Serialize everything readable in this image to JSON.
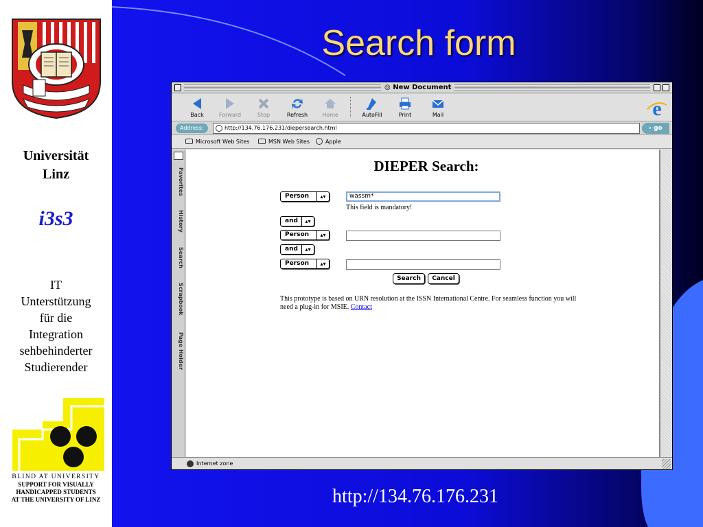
{
  "slide": {
    "title": "Search form",
    "footer_url": "http://134.76.176.231"
  },
  "sidebar": {
    "university": [
      "Universität",
      "Linz"
    ],
    "i3s3": "i3s3",
    "description": [
      "IT",
      "Unterstützung",
      "für die",
      "Integration",
      "sehbehinderter",
      "Studierender"
    ],
    "blind_logo_text": [
      "BLIND AT UNIVERSITY",
      "SUPPORT FOR VISUALLY",
      "HANDICAPPED STUDENTS",
      "AT THE UNIVERSITY OF LINZ"
    ]
  },
  "browser": {
    "window_title": "New Document",
    "toolbar": [
      {
        "label": "Back",
        "icon": "back-arrow-icon",
        "enabled": true
      },
      {
        "label": "Forward",
        "icon": "forward-arrow-icon",
        "enabled": false
      },
      {
        "label": "Stop",
        "icon": "stop-x-icon",
        "enabled": false
      },
      {
        "label": "Refresh",
        "icon": "refresh-icon",
        "enabled": true
      },
      {
        "label": "Home",
        "icon": "home-icon",
        "enabled": false
      },
      {
        "label": "AutoFill",
        "icon": "autofill-icon",
        "enabled": true
      },
      {
        "label": "Print",
        "icon": "printer-icon",
        "enabled": true
      },
      {
        "label": "Mail",
        "icon": "mail-icon",
        "enabled": true
      }
    ],
    "address_label": "Address:",
    "address_value": "http://134.76.176.231/diepersearch.html",
    "go_label": "go",
    "favorites": [
      "Microsoft Web Sites",
      "MSN Web Sites",
      "Apple"
    ],
    "explorer_tabs": [
      "Favorites",
      "History",
      "Search",
      "Scrapbook",
      "Page Holder"
    ],
    "status": "Internet zone"
  },
  "page": {
    "heading": "DIEPER Search:",
    "field1_select": "Person",
    "field1_value": "wassm*",
    "mandatory_hint": "This field is mandatory!",
    "op1": "and",
    "field2_select": "Person",
    "field2_value": "",
    "op2": "and",
    "field3_select": "Person",
    "field3_value": "",
    "search_label": "Search",
    "cancel_label": "Cancel",
    "info_text": "This prototype is based on URN resolution at the ISSN International Centre. For seamless function you will need a plug-in for MSIE.",
    "contact_link": "Contact"
  },
  "colors": {
    "title_text": "#ffd870",
    "slide_blue": "#1212ee",
    "accent_light_blue": "#3b6cff"
  }
}
